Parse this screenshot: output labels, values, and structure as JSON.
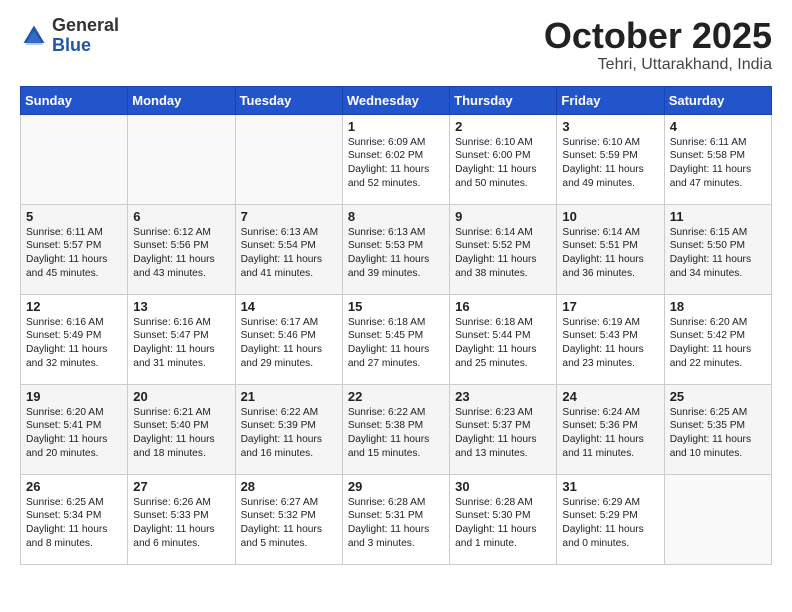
{
  "logo": {
    "general": "General",
    "blue": "Blue"
  },
  "title": "October 2025",
  "location": "Tehri, Uttarakhand, India",
  "weekdays": [
    "Sunday",
    "Monday",
    "Tuesday",
    "Wednesday",
    "Thursday",
    "Friday",
    "Saturday"
  ],
  "weeks": [
    [
      {
        "day": "",
        "info": ""
      },
      {
        "day": "",
        "info": ""
      },
      {
        "day": "",
        "info": ""
      },
      {
        "day": "1",
        "info": "Sunrise: 6:09 AM\nSunset: 6:02 PM\nDaylight: 11 hours\nand 52 minutes."
      },
      {
        "day": "2",
        "info": "Sunrise: 6:10 AM\nSunset: 6:00 PM\nDaylight: 11 hours\nand 50 minutes."
      },
      {
        "day": "3",
        "info": "Sunrise: 6:10 AM\nSunset: 5:59 PM\nDaylight: 11 hours\nand 49 minutes."
      },
      {
        "day": "4",
        "info": "Sunrise: 6:11 AM\nSunset: 5:58 PM\nDaylight: 11 hours\nand 47 minutes."
      }
    ],
    [
      {
        "day": "5",
        "info": "Sunrise: 6:11 AM\nSunset: 5:57 PM\nDaylight: 11 hours\nand 45 minutes."
      },
      {
        "day": "6",
        "info": "Sunrise: 6:12 AM\nSunset: 5:56 PM\nDaylight: 11 hours\nand 43 minutes."
      },
      {
        "day": "7",
        "info": "Sunrise: 6:13 AM\nSunset: 5:54 PM\nDaylight: 11 hours\nand 41 minutes."
      },
      {
        "day": "8",
        "info": "Sunrise: 6:13 AM\nSunset: 5:53 PM\nDaylight: 11 hours\nand 39 minutes."
      },
      {
        "day": "9",
        "info": "Sunrise: 6:14 AM\nSunset: 5:52 PM\nDaylight: 11 hours\nand 38 minutes."
      },
      {
        "day": "10",
        "info": "Sunrise: 6:14 AM\nSunset: 5:51 PM\nDaylight: 11 hours\nand 36 minutes."
      },
      {
        "day": "11",
        "info": "Sunrise: 6:15 AM\nSunset: 5:50 PM\nDaylight: 11 hours\nand 34 minutes."
      }
    ],
    [
      {
        "day": "12",
        "info": "Sunrise: 6:16 AM\nSunset: 5:49 PM\nDaylight: 11 hours\nand 32 minutes."
      },
      {
        "day": "13",
        "info": "Sunrise: 6:16 AM\nSunset: 5:47 PM\nDaylight: 11 hours\nand 31 minutes."
      },
      {
        "day": "14",
        "info": "Sunrise: 6:17 AM\nSunset: 5:46 PM\nDaylight: 11 hours\nand 29 minutes."
      },
      {
        "day": "15",
        "info": "Sunrise: 6:18 AM\nSunset: 5:45 PM\nDaylight: 11 hours\nand 27 minutes."
      },
      {
        "day": "16",
        "info": "Sunrise: 6:18 AM\nSunset: 5:44 PM\nDaylight: 11 hours\nand 25 minutes."
      },
      {
        "day": "17",
        "info": "Sunrise: 6:19 AM\nSunset: 5:43 PM\nDaylight: 11 hours\nand 23 minutes."
      },
      {
        "day": "18",
        "info": "Sunrise: 6:20 AM\nSunset: 5:42 PM\nDaylight: 11 hours\nand 22 minutes."
      }
    ],
    [
      {
        "day": "19",
        "info": "Sunrise: 6:20 AM\nSunset: 5:41 PM\nDaylight: 11 hours\nand 20 minutes."
      },
      {
        "day": "20",
        "info": "Sunrise: 6:21 AM\nSunset: 5:40 PM\nDaylight: 11 hours\nand 18 minutes."
      },
      {
        "day": "21",
        "info": "Sunrise: 6:22 AM\nSunset: 5:39 PM\nDaylight: 11 hours\nand 16 minutes."
      },
      {
        "day": "22",
        "info": "Sunrise: 6:22 AM\nSunset: 5:38 PM\nDaylight: 11 hours\nand 15 minutes."
      },
      {
        "day": "23",
        "info": "Sunrise: 6:23 AM\nSunset: 5:37 PM\nDaylight: 11 hours\nand 13 minutes."
      },
      {
        "day": "24",
        "info": "Sunrise: 6:24 AM\nSunset: 5:36 PM\nDaylight: 11 hours\nand 11 minutes."
      },
      {
        "day": "25",
        "info": "Sunrise: 6:25 AM\nSunset: 5:35 PM\nDaylight: 11 hours\nand 10 minutes."
      }
    ],
    [
      {
        "day": "26",
        "info": "Sunrise: 6:25 AM\nSunset: 5:34 PM\nDaylight: 11 hours\nand 8 minutes."
      },
      {
        "day": "27",
        "info": "Sunrise: 6:26 AM\nSunset: 5:33 PM\nDaylight: 11 hours\nand 6 minutes."
      },
      {
        "day": "28",
        "info": "Sunrise: 6:27 AM\nSunset: 5:32 PM\nDaylight: 11 hours\nand 5 minutes."
      },
      {
        "day": "29",
        "info": "Sunrise: 6:28 AM\nSunset: 5:31 PM\nDaylight: 11 hours\nand 3 minutes."
      },
      {
        "day": "30",
        "info": "Sunrise: 6:28 AM\nSunset: 5:30 PM\nDaylight: 11 hours\nand 1 minute."
      },
      {
        "day": "31",
        "info": "Sunrise: 6:29 AM\nSunset: 5:29 PM\nDaylight: 11 hours\nand 0 minutes."
      },
      {
        "day": "",
        "info": ""
      }
    ]
  ]
}
